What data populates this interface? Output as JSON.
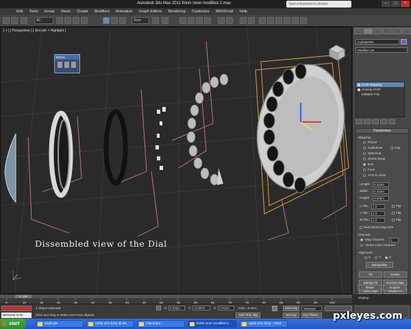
{
  "title_bar": {
    "title": "Autodesk 3ds Max  2011     finish inner modified 2.max",
    "search_placeholder": "Type a keyword or phrase"
  },
  "menu": [
    "Edit",
    "Tools",
    "Group",
    "Views",
    "Create",
    "Modifiers",
    "Animation",
    "Graph Editors",
    "Rendering",
    "Customize",
    "MAXScript",
    "Help"
  ],
  "toolbar": {
    "selection_filter": "All",
    "reference_coord": "View"
  },
  "viewport": {
    "label": "[ + ] [ Perspective ] [ Smooth + Highlight ]",
    "caption": "Dissembled view of the Dial",
    "float_panel_title": "Extras"
  },
  "command_panel": {
    "object_name": "Cylinder001",
    "modifier_list": "Modifier List",
    "stack": [
      "UVW Mapping",
      "Unwrap UVW",
      "Editable Poly"
    ],
    "rollout_title": "Parameters",
    "mapping_label": "Mapping:",
    "mapping_options": [
      "Planar",
      "Cylindrical",
      "Spherical",
      "Shrink Wrap",
      "Box",
      "Face",
      "XYZ to UVW"
    ],
    "mapping_selected": "Box",
    "cap_label": "Cap",
    "length_label": "Length:",
    "length_value": "0.310m",
    "width_label": "Width:",
    "width_value": "0.310m",
    "height_label": "Height:",
    "height_value": "0.009m",
    "u_tile_label": "U Tile:",
    "u_tile_value": "1.0",
    "v_tile_label": "V Tile:",
    "v_tile_value": "1.0",
    "w_tile_label": "W Tile:",
    "w_tile_value": "1.0",
    "flip_label": "Flip",
    "real_world_label": "Real-World Map Size",
    "channel_label": "Channel:",
    "map_channel_label": "Map Channel:",
    "map_channel_value": "1",
    "vertex_color_label": "Vertex Color Channel",
    "alignment_label": "Alignment:",
    "axis_x": "X",
    "axis_y": "Y",
    "axis_z": "Z",
    "buttons": [
      "Manipulate",
      "Fit",
      "Center",
      "Bitmap Fit",
      "Normal Align",
      "View Align",
      "Region Fit",
      "Reset",
      "Acquire"
    ],
    "display_label": "Display:"
  },
  "timeline": {
    "frame": "0 / 100",
    "ticks": [
      "0",
      "10",
      "15",
      "20",
      "25",
      "30",
      "35",
      "40",
      "45",
      "50",
      "55",
      "60",
      "65",
      "70",
      "75",
      "80",
      "85",
      "90",
      "95",
      "100"
    ]
  },
  "status": {
    "selected": "1 Object Selected",
    "prompt": "Click and drag to select and move objects",
    "x_label": "X:",
    "x_value": "0.026m",
    "y_label": "Y:",
    "y_value": "-0.025m",
    "z_label": "Z:",
    "z_value": "0.019m",
    "grid": "Grid = 0.01m",
    "add_time_tag": "Add Time Tag",
    "auto_key": "Auto Key",
    "selected_dd": "Selected",
    "set_key": "Set Key",
    "key_filters": "Key Filters...",
    "welcome": "Welcome to M:"
  },
  "taskbar": {
    "start": "start",
    "items": [
      "duplicate",
      "cable wire.bmp @ 66...",
      "Calculator",
      "finish inner modified 2...",
      "cable wire.bmp - Paint"
    ]
  },
  "watermark": "pxleyes.com"
}
